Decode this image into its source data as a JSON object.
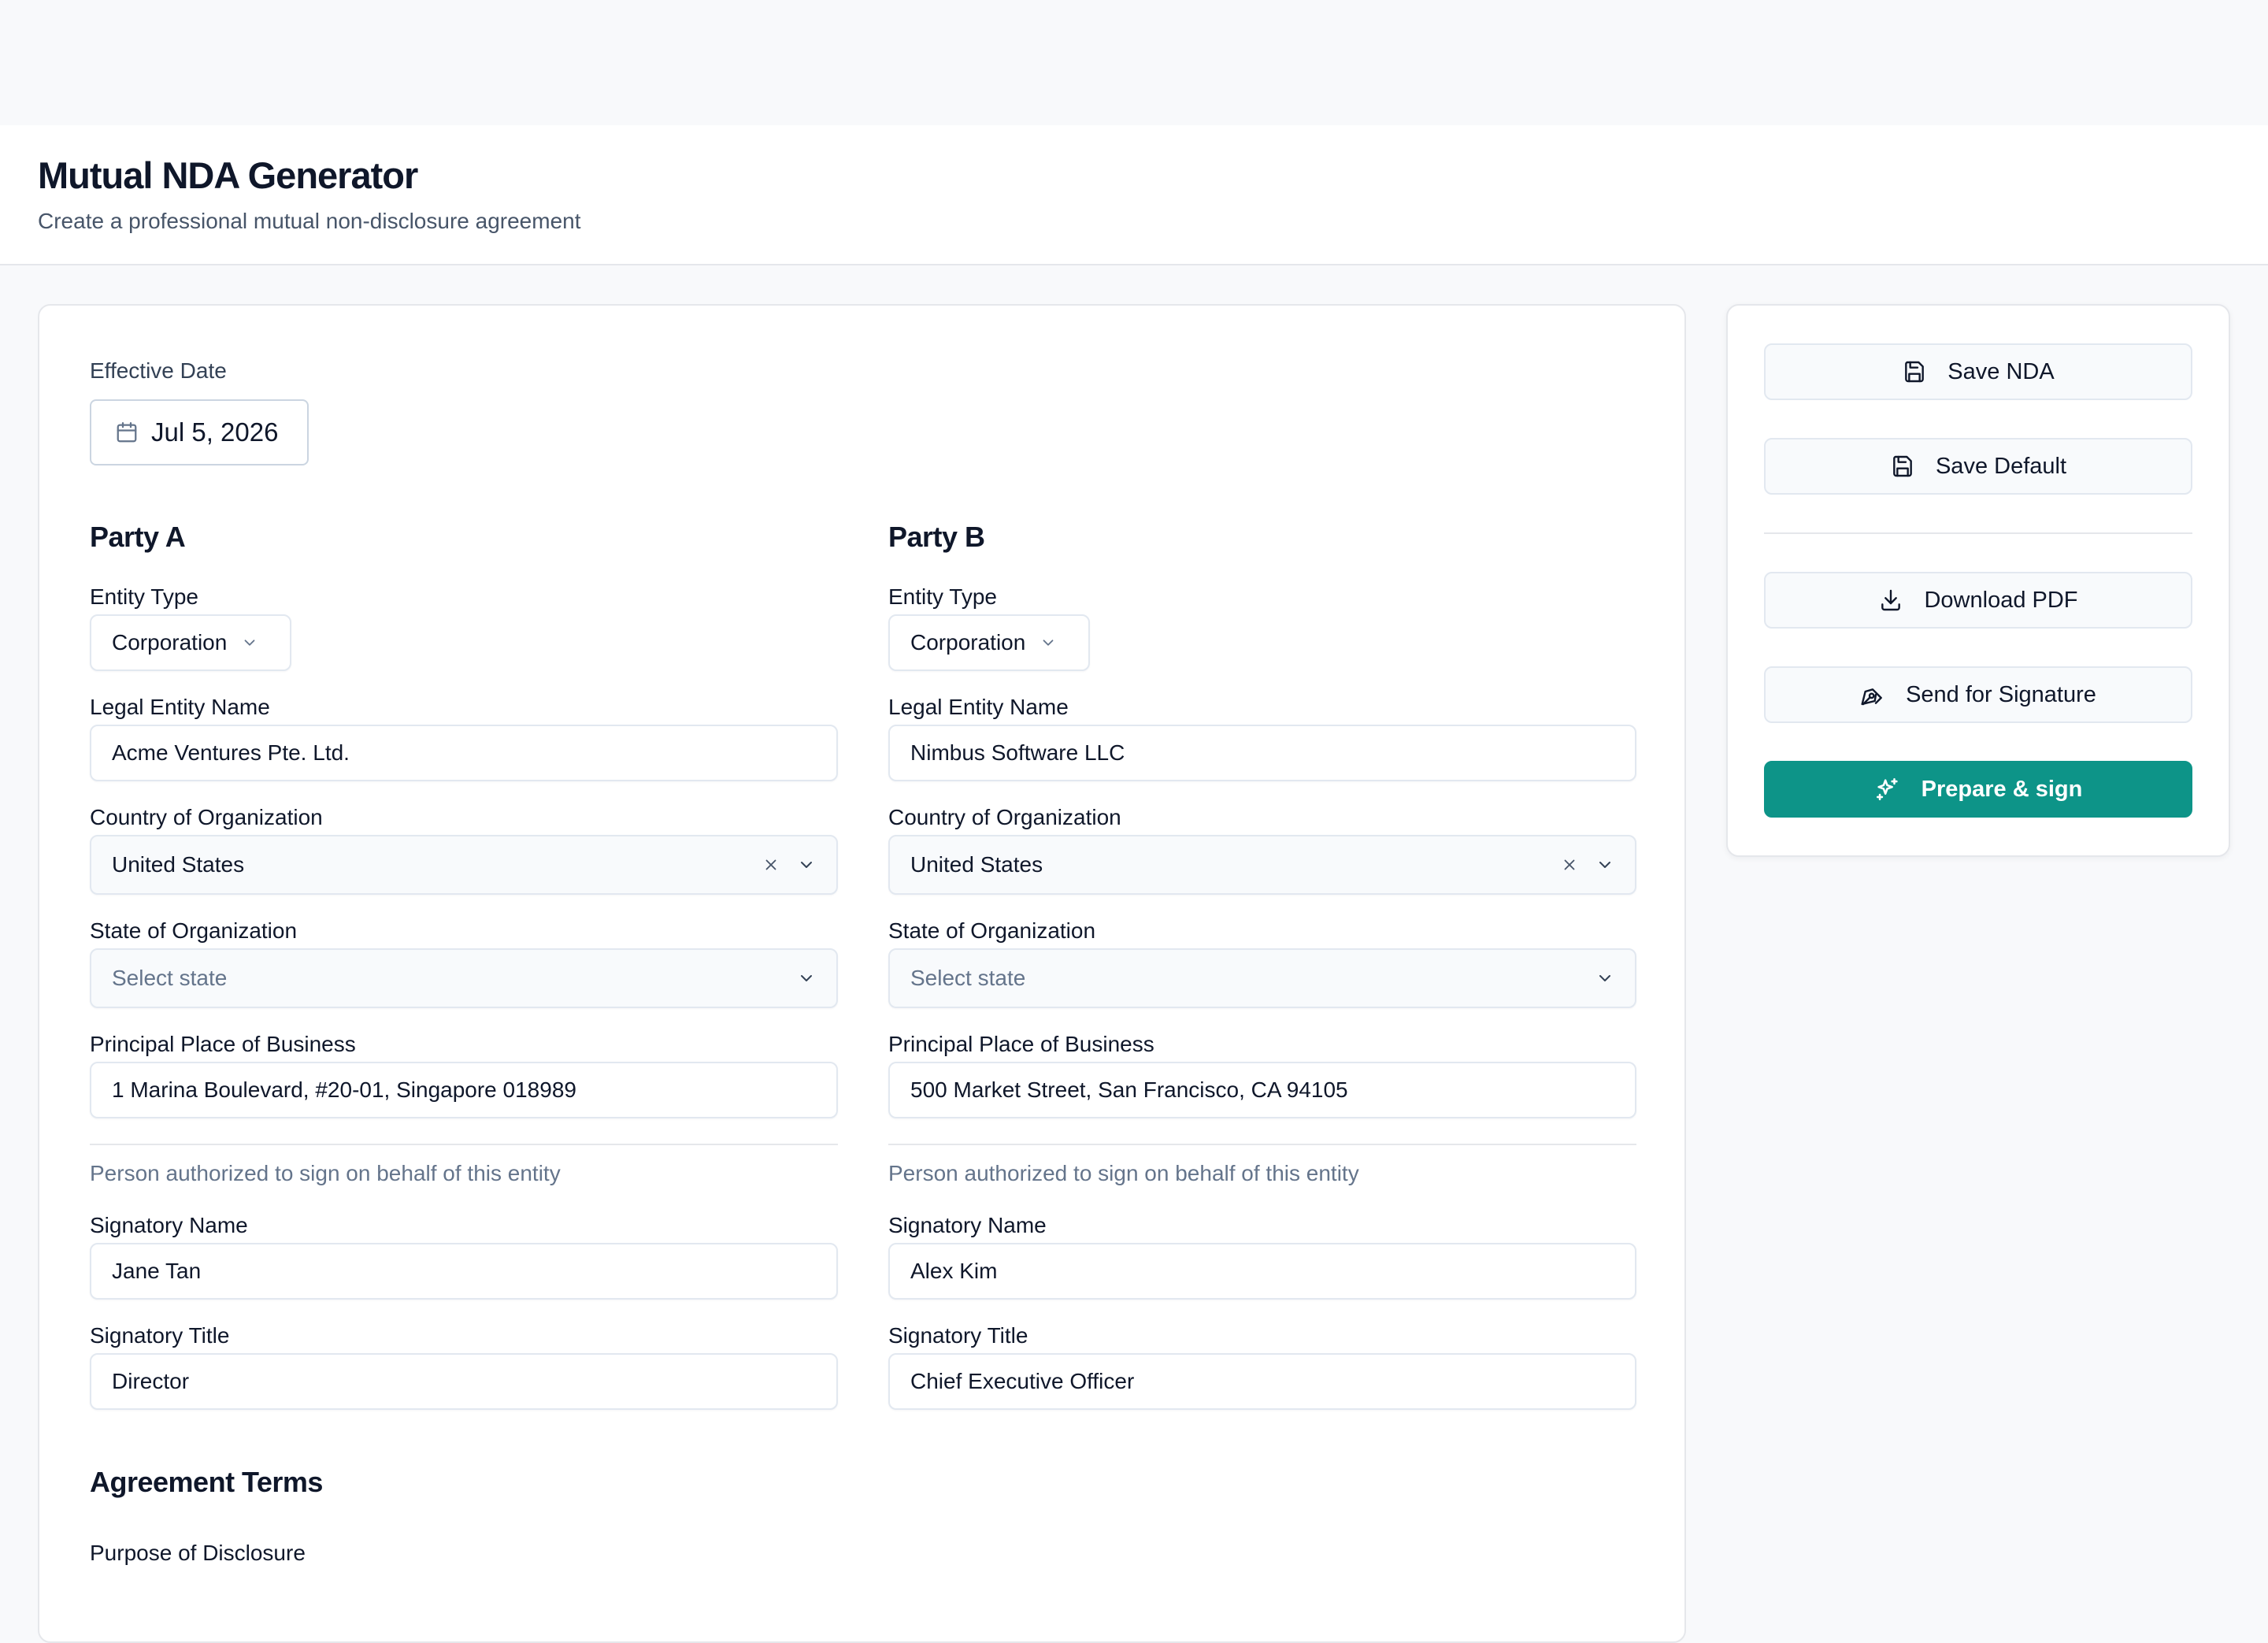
{
  "header": {
    "title": "Mutual NDA Generator",
    "subtitle": "Create a professional mutual non-disclosure agreement"
  },
  "effective_date": {
    "label": "Effective Date",
    "value": "Jul 5, 2026",
    "icon": "calendar-icon"
  },
  "party_a": {
    "title": "Party A",
    "entity_type_label": "Entity Type",
    "entity_type_value": "Corporation",
    "legal_name_label": "Legal Entity Name",
    "legal_name_value": "Acme Ventures Pte. Ltd.",
    "country_label": "Country of Organization",
    "country_value": "United States",
    "state_label": "State of Organization",
    "state_placeholder": "Select state",
    "address_label": "Principal Place of Business",
    "address_value": "1 Marina Boulevard, #20-01, Singapore 018989",
    "signatory_hint": "Person authorized to sign on behalf of this entity",
    "signatory_name_label": "Signatory Name",
    "signatory_name_value": "Jane Tan",
    "signatory_title_label": "Signatory Title",
    "signatory_title_value": "Director"
  },
  "party_b": {
    "title": "Party B",
    "entity_type_label": "Entity Type",
    "entity_type_value": "Corporation",
    "legal_name_label": "Legal Entity Name",
    "legal_name_value": "Nimbus Software LLC",
    "country_label": "Country of Organization",
    "country_value": "United States",
    "state_label": "State of Organization",
    "state_placeholder": "Select state",
    "address_label": "Principal Place of Business",
    "address_value": "500 Market Street, San Francisco, CA 94105",
    "signatory_hint": "Person authorized to sign on behalf of this entity",
    "signatory_name_label": "Signatory Name",
    "signatory_name_value": "Alex Kim",
    "signatory_title_label": "Signatory Title",
    "signatory_title_value": "Chief Executive Officer"
  },
  "agreement_terms": {
    "title": "Agreement Terms",
    "purpose_label": "Purpose of Disclosure"
  },
  "actions": {
    "save_nda": "Save NDA",
    "save_default": "Save Default",
    "download_pdf": "Download PDF",
    "send_for_signature": "Send for Signature",
    "prepare_sign": "Prepare & sign"
  },
  "colors": {
    "accent": "#0d9488",
    "page_background": "#f8f9fb",
    "text_primary": "#0f172a",
    "text_muted": "#64748b",
    "border": "#e2e8f0"
  },
  "icons": {
    "save_nda": "save-icon",
    "save_default": "save-icon",
    "download_pdf": "download-icon",
    "send_for_signature": "pen-icon",
    "prepare_sign": "sparkles-icon",
    "dropdown": "chevron-down-icon",
    "clear": "close-icon"
  }
}
